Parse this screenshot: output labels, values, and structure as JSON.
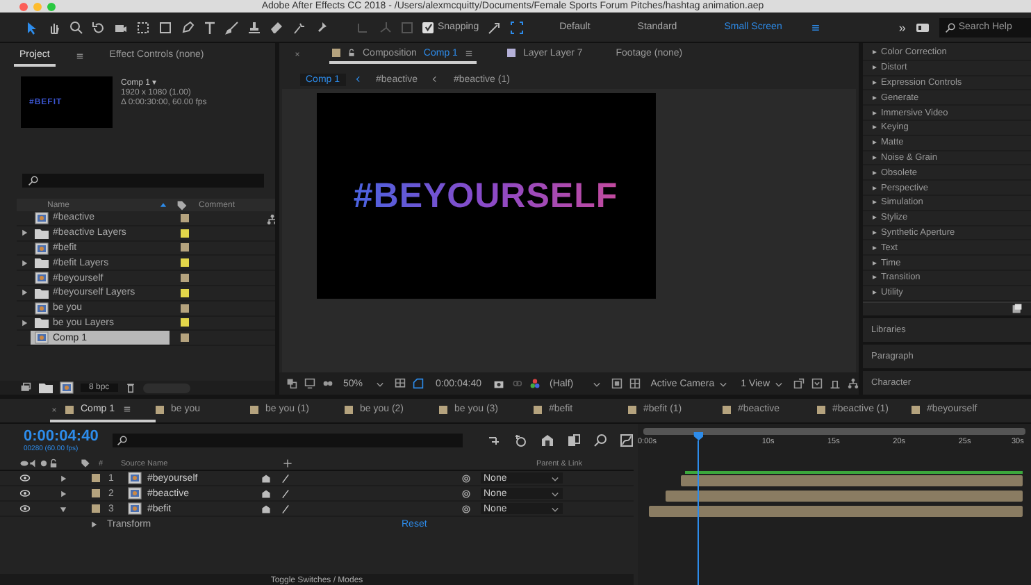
{
  "window": {
    "title": "Adobe After Effects CC 2018 - /Users/alexmcquitty/Documents/Female Sports Forum Pitches/hashtag animation.aep"
  },
  "toolbar": {
    "snapping": {
      "label": "Snapping",
      "checked": true
    },
    "workspaces": [
      {
        "label": "Default",
        "selected": false
      },
      {
        "label": "Standard",
        "selected": false
      },
      {
        "label": "Small Screen",
        "selected": true
      }
    ],
    "overflow": "»",
    "search": {
      "placeholder": "Search Help"
    }
  },
  "project_panel": {
    "tabs": [
      {
        "label": "Project",
        "selected": true
      },
      {
        "label": "Effect Controls (none)",
        "selected": false
      }
    ],
    "preview": {
      "thumbnail_text": "#BEFIT",
      "name": "Comp 1 ▾",
      "info": [
        "1920 x 1080 (1.00)",
        "Δ 0:00:30:00, 60.00 fps"
      ]
    },
    "columns": [
      "Name",
      "Comment"
    ],
    "items": [
      {
        "name": "#beactive",
        "kind": "comp",
        "color": "#b5a37e",
        "selected": false
      },
      {
        "name": "#beactive Layers",
        "kind": "folder",
        "color": "#e3d64a",
        "selected": false
      },
      {
        "name": "#befit",
        "kind": "comp",
        "color": "#b5a37e",
        "selected": false
      },
      {
        "name": "#befit Layers",
        "kind": "folder",
        "color": "#e3d64a",
        "selected": false
      },
      {
        "name": "#beyourself",
        "kind": "comp",
        "color": "#b5a37e",
        "selected": false
      },
      {
        "name": "#beyourself Layers",
        "kind": "folder",
        "color": "#e3d64a",
        "selected": false
      },
      {
        "name": "be you",
        "kind": "comp",
        "color": "#b5a37e",
        "selected": false
      },
      {
        "name": "be you Layers",
        "kind": "folder",
        "color": "#e3d64a",
        "selected": false
      },
      {
        "name": "Comp 1",
        "kind": "comp",
        "color": "#b5a37e",
        "selected": true
      }
    ],
    "bpc": "8 bpc"
  },
  "composition_panel": {
    "tabs": [
      {
        "prefix": "Composition",
        "label": "Comp 1",
        "color": "#b5a37e",
        "selected": true
      },
      {
        "prefix": "Layer",
        "label": "Layer 7",
        "color": "#b4b0d8",
        "selected": false
      },
      {
        "label": "Footage (none)",
        "selected": false
      }
    ],
    "breadcrumbs": [
      {
        "label": "Comp 1",
        "selected": true
      },
      {
        "label": "#beactive",
        "selected": false
      },
      {
        "label": "#beactive (1)",
        "selected": false
      }
    ],
    "canvas_text": "#BEYOURSELF",
    "controls": {
      "zoom": "50%",
      "time": "0:00:04:40",
      "resolution": "(Half)",
      "camera": "Active Camera",
      "views": "1 View"
    }
  },
  "effects_panel": {
    "categories": [
      "Color Correction",
      "Distort",
      "Expression Controls",
      "Generate",
      "Immersive Video",
      "Keying",
      "Matte",
      "Noise & Grain",
      "Obsolete",
      "Perspective",
      "Simulation",
      "Stylize",
      "Synthetic Aperture",
      "Text",
      "Time",
      "Transition",
      "Utility"
    ],
    "panels": [
      "Libraries",
      "Paragraph",
      "Character"
    ]
  },
  "timeline": {
    "tabs": [
      {
        "label": "Comp 1",
        "selected": true
      },
      {
        "label": "be you",
        "selected": false
      },
      {
        "label": "be you (1)",
        "selected": false
      },
      {
        "label": "be you (2)",
        "selected": false
      },
      {
        "label": "be you (3)",
        "selected": false
      },
      {
        "label": "#befit",
        "selected": false
      },
      {
        "label": "#befit (1)",
        "selected": false
      },
      {
        "label": "#beactive",
        "selected": false
      },
      {
        "label": "#beactive (1)",
        "selected": false
      },
      {
        "label": "#beyourself",
        "selected": false
      }
    ],
    "current_time": "0:00:04:40",
    "frame": "00280 (60.00 fps)",
    "columns": {
      "number": "#",
      "source": "Source Name",
      "parent": "Parent & Link"
    },
    "layers": [
      {
        "number": "1",
        "name": "#beyourself",
        "expanded": false,
        "parent": "None"
      },
      {
        "number": "2",
        "name": "#beactive",
        "expanded": false,
        "parent": "None"
      },
      {
        "number": "3",
        "name": "#befit",
        "expanded": true,
        "parent": "None"
      }
    ],
    "property": {
      "name": "Transform",
      "action": "Reset"
    },
    "ruler": [
      "0:00s",
      "10s",
      "15s",
      "20s",
      "25s",
      "30s"
    ],
    "footer": "Toggle Switches / Modes"
  }
}
